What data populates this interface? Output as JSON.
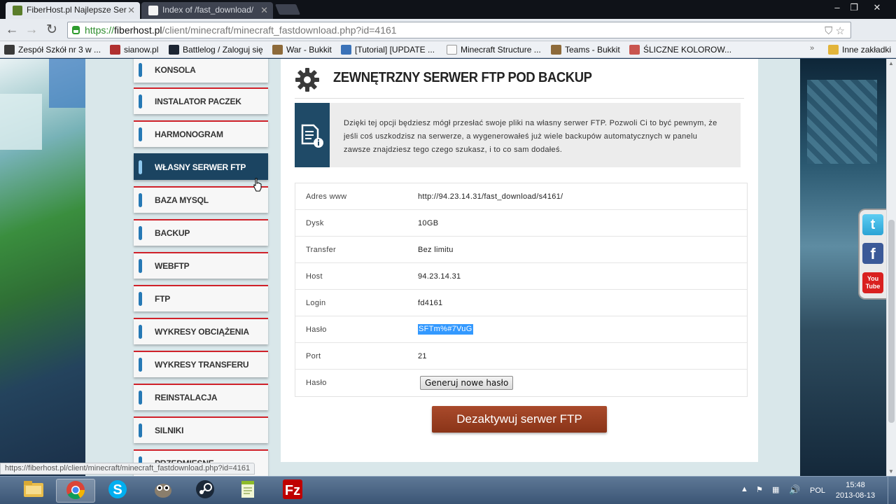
{
  "browser": {
    "tabs": [
      {
        "title": "FiberHost.pl Najlepsze Ser",
        "active": true
      },
      {
        "title": "Index of /fast_download/",
        "active": false
      }
    ],
    "url_scheme": "https://",
    "url_host": "fiberhost.pl",
    "url_path": "/client/minecraft/minecraft_fastdownload.php?id=4161",
    "bookmarks": [
      "Zespół Szkół nr 3 w ...",
      "sianow.pl",
      "Battlelog / Zaloguj się",
      "War - Bukkit",
      "[Tutorial] [UPDATE ...",
      "Minecraft Structure ...",
      "Teams - Bukkit",
      "ŚLICZNE KOLOROW..."
    ],
    "other_bookmarks": "Inne zakładki",
    "status_url": "https://fiberhost.pl/client/minecraft/minecraft_fastdownload.php?id=4161"
  },
  "sidebar": {
    "items": [
      {
        "label": "KONSOLA"
      },
      {
        "label": "INSTALATOR PACZEK"
      },
      {
        "label": "HARMONOGRAM"
      },
      {
        "label": "WŁASNY SERWER FTP",
        "active": true
      },
      {
        "label": "BAZA MYSQL"
      },
      {
        "label": "BACKUP"
      },
      {
        "label": "WEBFTP"
      },
      {
        "label": "FTP"
      },
      {
        "label": "WYKRESY OBCIĄŻENIA"
      },
      {
        "label": "WYKRESY TRANSFERU"
      },
      {
        "label": "REINSTALACJA"
      },
      {
        "label": "SILNIKI"
      },
      {
        "label": "PRZEDMIESNE"
      }
    ]
  },
  "main": {
    "title": "ZEWNĘTRZNY SERWER FTP POD BACKUP",
    "info_text": "Dzięki tej opcji będziesz mógł przesłać swoje pliki na własny serwer FTP. Pozwoli Ci to być pewnym, że jeśli coś uszkodzisz na serwerze, a wygenerowałeś już wiele backupów automatycznych w panelu zawsze znajdziesz tego czego szukasz, i to co sam dodałeś.",
    "details": [
      {
        "label": "Adres www",
        "value": "http://94.23.14.31/fast_download/s4161/"
      },
      {
        "label": "Dysk",
        "value": "10GB"
      },
      {
        "label": "Transfer",
        "value": "Bez limitu"
      },
      {
        "label": "Host",
        "value": "94.23.14.31"
      },
      {
        "label": "Login",
        "value": "fd4161"
      },
      {
        "label": "Hasło",
        "value": "SFTm%#7VuG"
      },
      {
        "label": "Port",
        "value": "21"
      },
      {
        "label": "Hasło",
        "button": "Generuj nowe hasło"
      }
    ],
    "deactivate_button": "Dezaktywuj serwer FTP"
  },
  "taskbar": {
    "language": "POL",
    "time": "15:48",
    "date": "2013-08-13"
  },
  "colors": {
    "accent_red": "#d0212a",
    "sidebar_active": "#1b4461",
    "pill_blue": "#2679b5",
    "button_brown": "#9a3f22",
    "selection": "#3399ff"
  }
}
